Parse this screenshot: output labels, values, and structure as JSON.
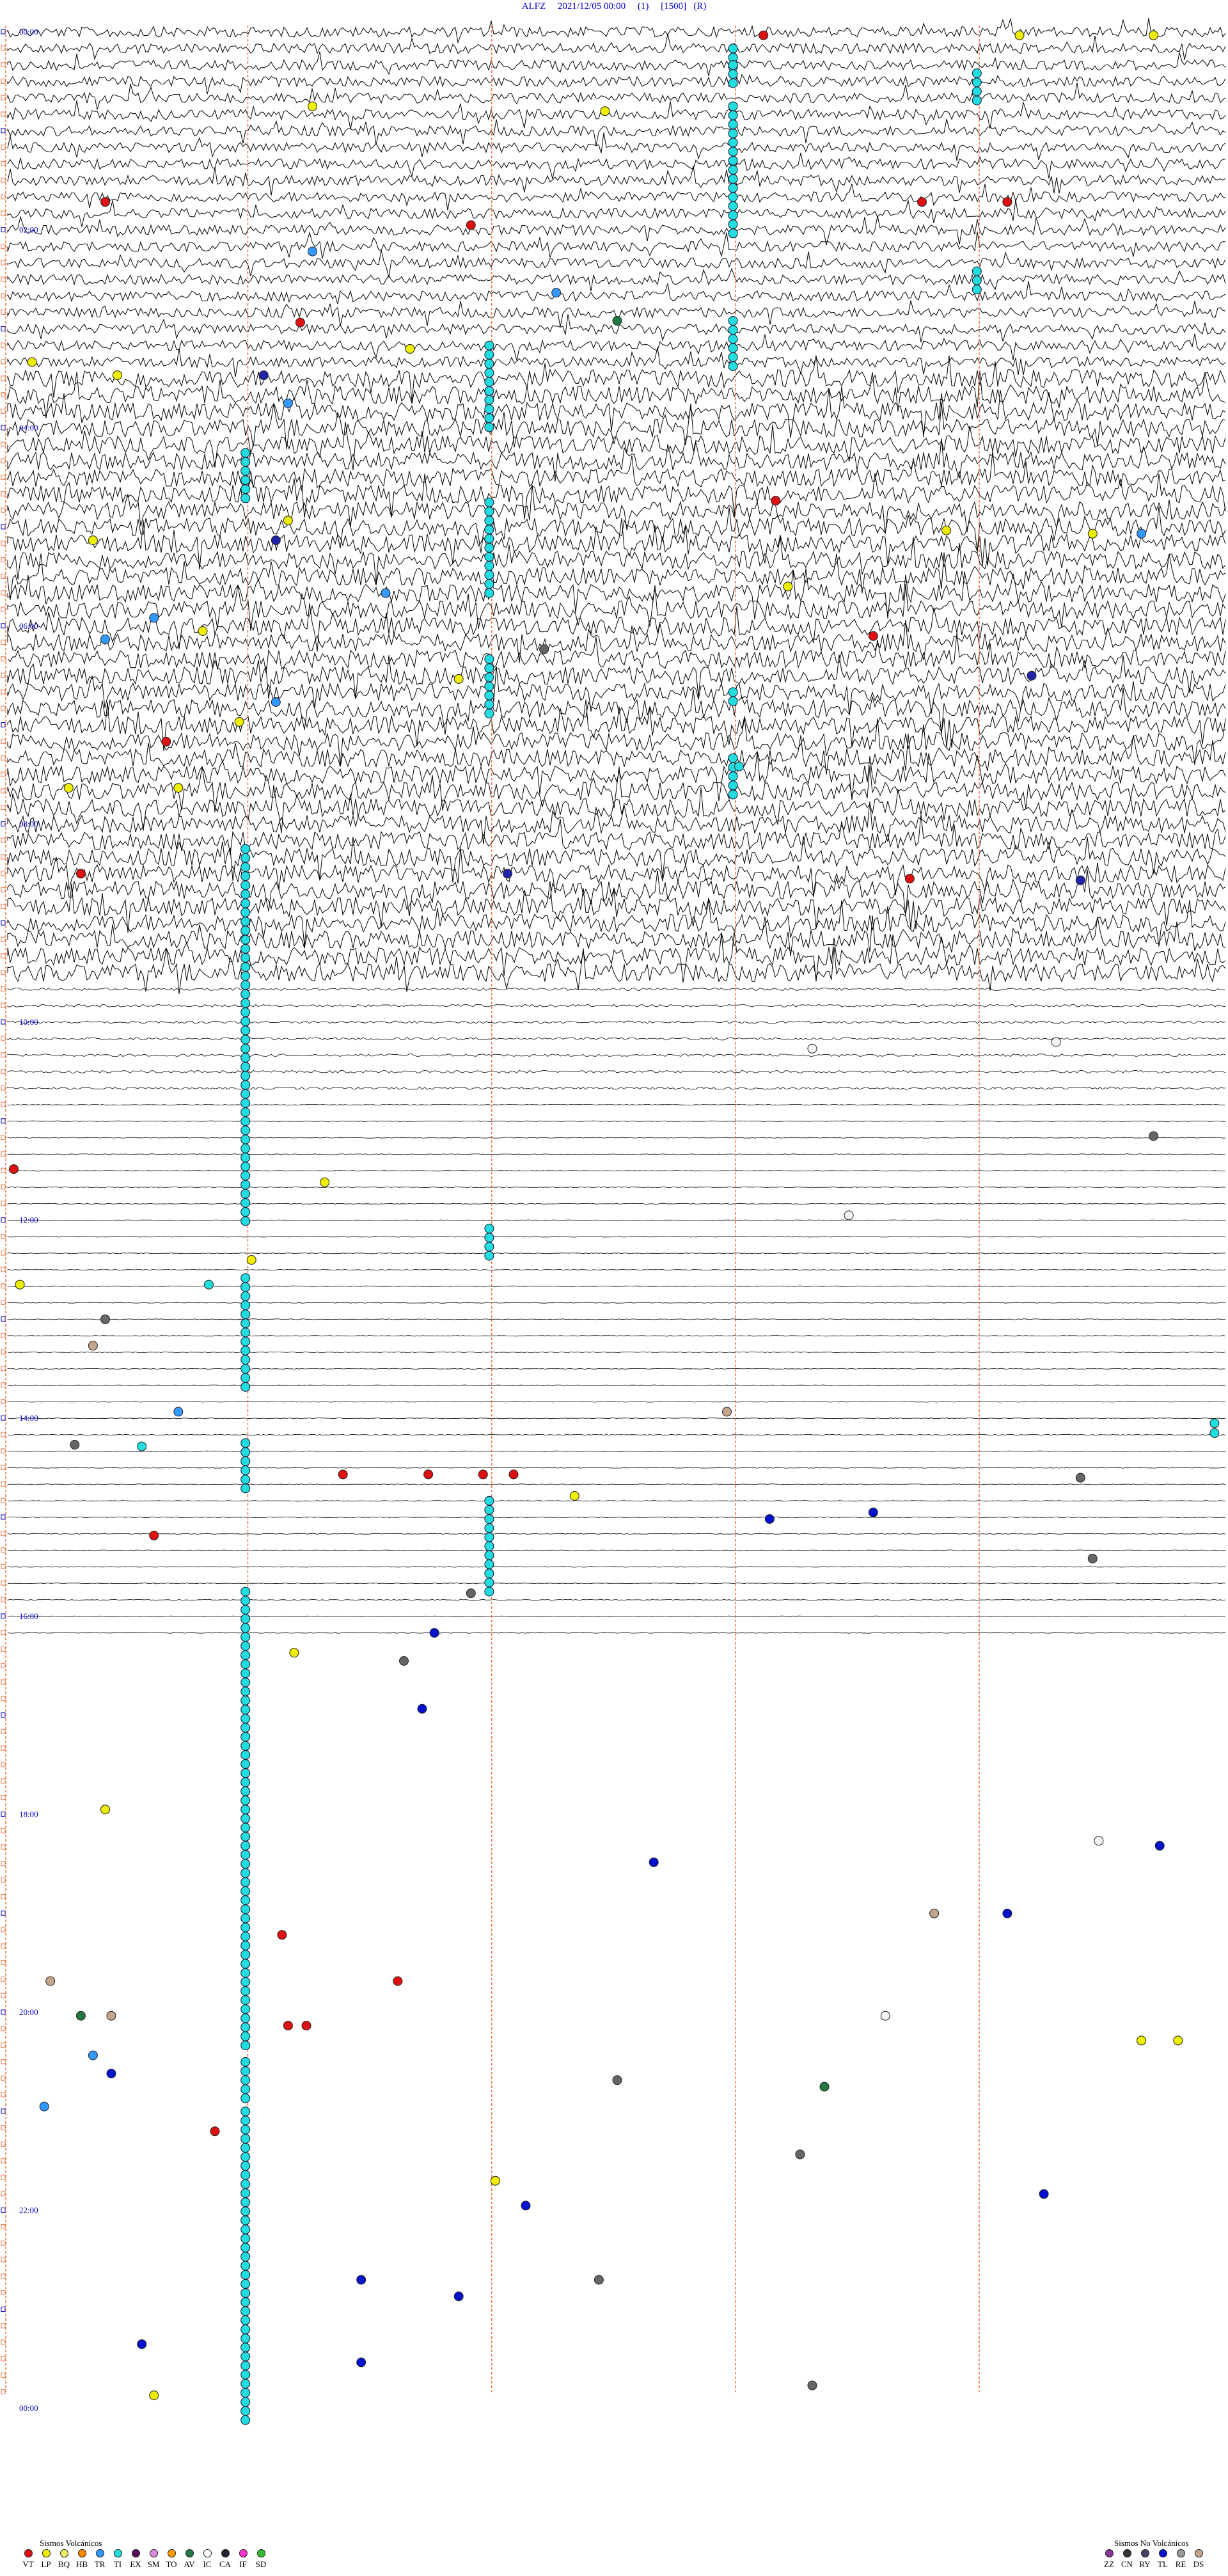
{
  "header": {
    "station": "ALFZ",
    "datetime": "2021/12/05 00:00",
    "channel": "(1)",
    "scale": "[1500]",
    "mode": "(R)"
  },
  "chart_data": {
    "type": "scatter",
    "rows_per_hour": 6,
    "hours": 24,
    "hour_labels": [
      "00:00",
      "02:00",
      "04:00",
      "06:00",
      "08:00",
      "10:00",
      "12:00",
      "14:00",
      "16:00",
      "18:00",
      "20:00",
      "22:00",
      "00:00"
    ],
    "x_range": [
      0,
      10
    ],
    "row_range": [
      0,
      145
    ],
    "trace_until_row": 97,
    "x_unit": "minutes after row start",
    "row_unit": "10-minute row index",
    "trace_notes": "seismic waveform traces drawn rows 0-97; dense rows 0-57",
    "events": [
      {
        "row": 0.2,
        "x": 6.2,
        "type": "VT"
      },
      {
        "row": 0.2,
        "x": 8.3,
        "type": "LP"
      },
      {
        "row": 0.2,
        "x": 9.4,
        "type": "LP"
      },
      {
        "row": 4.5,
        "x": 2.5,
        "type": "LP"
      },
      {
        "row": 4.8,
        "x": 4.9,
        "type": "LP"
      },
      {
        "row": 10.3,
        "x": 0.8,
        "type": "VT"
      },
      {
        "row": 10.3,
        "x": 7.5,
        "type": "VT"
      },
      {
        "row": 10.3,
        "x": 8.2,
        "type": "VT"
      },
      {
        "row": 11.7,
        "x": 3.8,
        "type": "VT"
      },
      {
        "row": 13.3,
        "x": 2.5,
        "type": "TR"
      },
      {
        "row": 15.8,
        "x": 4.5,
        "type": "TR"
      },
      {
        "row": 17.5,
        "x": 5.0,
        "type": "AV"
      },
      {
        "row": 17.6,
        "x": 2.4,
        "type": "VT"
      },
      {
        "row": 19.2,
        "x": 3.3,
        "type": "LP"
      },
      {
        "row": 20.0,
        "x": 0.2,
        "type": "LP"
      },
      {
        "row": 20.8,
        "x": 0.9,
        "type": "LP"
      },
      {
        "row": 20.8,
        "x": 2.1,
        "type": "RY"
      },
      {
        "row": 22.5,
        "x": 2.3,
        "type": "TR"
      },
      {
        "row": 28.4,
        "x": 6.3,
        "type": "VT"
      },
      {
        "row": 29.6,
        "x": 2.3,
        "type": "LP"
      },
      {
        "row": 30.2,
        "x": 7.7,
        "type": "LP"
      },
      {
        "row": 30.4,
        "x": 8.9,
        "type": "LP"
      },
      {
        "row": 30.4,
        "x": 9.3,
        "type": "TR"
      },
      {
        "row": 30.8,
        "x": 0.7,
        "type": "LP"
      },
      {
        "row": 30.8,
        "x": 2.2,
        "type": "RY"
      },
      {
        "row": 33.6,
        "x": 6.4,
        "type": "LP"
      },
      {
        "row": 34.0,
        "x": 3.1,
        "type": "TR"
      },
      {
        "row": 35.5,
        "x": 1.2,
        "type": "TR"
      },
      {
        "row": 36.3,
        "x": 1.6,
        "type": "LP"
      },
      {
        "row": 36.6,
        "x": 7.1,
        "type": "VT"
      },
      {
        "row": 36.8,
        "x": 0.8,
        "type": "TR"
      },
      {
        "row": 37.4,
        "x": 4.4,
        "type": "ZZ"
      },
      {
        "row": 39.0,
        "x": 8.4,
        "type": "RY"
      },
      {
        "row": 39.2,
        "x": 3.7,
        "type": "LP"
      },
      {
        "row": 40.6,
        "x": 2.2,
        "type": "TR"
      },
      {
        "row": 41.8,
        "x": 1.9,
        "type": "LP"
      },
      {
        "row": 43.0,
        "x": 1.3,
        "type": "VT"
      },
      {
        "row": 44.5,
        "x": 6.0,
        "type": "TI"
      },
      {
        "row": 45.8,
        "x": 0.5,
        "type": "LP"
      },
      {
        "row": 45.8,
        "x": 1.4,
        "type": "LP"
      },
      {
        "row": 51.0,
        "x": 0.6,
        "type": "VT"
      },
      {
        "row": 51.0,
        "x": 4.1,
        "type": "RY"
      },
      {
        "row": 51.3,
        "x": 7.4,
        "type": "VT"
      },
      {
        "row": 51.4,
        "x": 8.8,
        "type": "RY"
      },
      {
        "row": 61.2,
        "x": 8.6,
        "type": "IC"
      },
      {
        "row": 61.6,
        "x": 6.6,
        "type": "IC"
      },
      {
        "row": 66.9,
        "x": 9.4,
        "type": "ZZ"
      },
      {
        "row": 68.9,
        "x": 0.05,
        "type": "VT"
      },
      {
        "row": 69.7,
        "x": 2.6,
        "type": "LP"
      },
      {
        "row": 71.7,
        "x": 6.9,
        "type": "IC"
      },
      {
        "row": 74.4,
        "x": 2.0,
        "type": "LP"
      },
      {
        "row": 75.9,
        "x": 0.1,
        "type": "LP"
      },
      {
        "row": 75.9,
        "x": 1.65,
        "type": "TI"
      },
      {
        "row": 78.0,
        "x": 0.8,
        "type": "ZZ"
      },
      {
        "row": 79.6,
        "x": 0.7,
        "type": "DS"
      },
      {
        "row": 83.6,
        "x": 1.4,
        "type": "TR"
      },
      {
        "row": 83.6,
        "x": 5.9,
        "type": "DS"
      },
      {
        "row": 84.3,
        "x": 9.9,
        "type": "TI"
      },
      {
        "row": 84.9,
        "x": 9.9,
        "type": "TI"
      },
      {
        "row": 85.6,
        "x": 0.55,
        "type": "ZZ"
      },
      {
        "row": 85.7,
        "x": 1.1,
        "type": "TI"
      },
      {
        "row": 87.4,
        "x": 2.75,
        "type": "VT"
      },
      {
        "row": 87.4,
        "x": 3.45,
        "type": "VT"
      },
      {
        "row": 87.4,
        "x": 3.9,
        "type": "VT"
      },
      {
        "row": 87.4,
        "x": 4.15,
        "type": "VT"
      },
      {
        "row": 87.6,
        "x": 8.8,
        "type": "ZZ"
      },
      {
        "row": 88.7,
        "x": 4.65,
        "type": "LP"
      },
      {
        "row": 90.1,
        "x": 6.25,
        "type": "TL"
      },
      {
        "row": 89.7,
        "x": 7.1,
        "type": "TL"
      },
      {
        "row": 91.1,
        "x": 1.2,
        "type": "VT"
      },
      {
        "row": 92.5,
        "x": 8.9,
        "type": "ZZ"
      },
      {
        "row": 94.6,
        "x": 3.8,
        "type": "ZZ"
      },
      {
        "row": 97.0,
        "x": 3.5,
        "type": "TL"
      },
      {
        "row": 98.2,
        "x": 2.35,
        "type": "LP"
      },
      {
        "row": 98.7,
        "x": 3.25,
        "type": "ZZ"
      },
      {
        "row": 101.6,
        "x": 3.4,
        "type": "TL"
      },
      {
        "row": 107.7,
        "x": 0.8,
        "type": "LP"
      },
      {
        "row": 109.6,
        "x": 8.95,
        "type": "IC"
      },
      {
        "row": 109.9,
        "x": 9.45,
        "type": "TL"
      },
      {
        "row": 110.9,
        "x": 5.3,
        "type": "TL"
      },
      {
        "row": 114.0,
        "x": 7.6,
        "type": "DS"
      },
      {
        "row": 114.0,
        "x": 8.2,
        "type": "TL"
      },
      {
        "row": 115.3,
        "x": 2.25,
        "type": "VT"
      },
      {
        "row": 118.1,
        "x": 0.35,
        "type": "DS"
      },
      {
        "row": 118.1,
        "x": 3.2,
        "type": "VT"
      },
      {
        "row": 120.2,
        "x": 0.6,
        "type": "AV"
      },
      {
        "row": 120.2,
        "x": 0.85,
        "type": "DS"
      },
      {
        "row": 120.2,
        "x": 7.2,
        "type": "IC"
      },
      {
        "row": 120.8,
        "x": 2.3,
        "type": "VT"
      },
      {
        "row": 120.8,
        "x": 2.45,
        "type": "VT"
      },
      {
        "row": 121.7,
        "x": 9.3,
        "type": "LP"
      },
      {
        "row": 121.7,
        "x": 9.6,
        "type": "LP"
      },
      {
        "row": 122.6,
        "x": 0.7,
        "type": "TR"
      },
      {
        "row": 123.7,
        "x": 0.85,
        "type": "TL"
      },
      {
        "row": 124.1,
        "x": 5.0,
        "type": "ZZ"
      },
      {
        "row": 124.5,
        "x": 6.7,
        "type": "AV"
      },
      {
        "row": 125.7,
        "x": 0.3,
        "type": "TR"
      },
      {
        "row": 127.2,
        "x": 1.7,
        "type": "VT"
      },
      {
        "row": 128.6,
        "x": 6.5,
        "type": "ZZ"
      },
      {
        "row": 130.2,
        "x": 4.0,
        "type": "LP"
      },
      {
        "row": 131.0,
        "x": 8.5,
        "type": "TL"
      },
      {
        "row": 131.7,
        "x": 4.25,
        "type": "TL"
      },
      {
        "row": 136.2,
        "x": 2.9,
        "type": "TL"
      },
      {
        "row": 136.2,
        "x": 4.85,
        "type": "ZZ"
      },
      {
        "row": 137.2,
        "x": 3.7,
        "type": "TL"
      },
      {
        "row": 140.1,
        "x": 1.1,
        "type": "TL"
      },
      {
        "row": 141.2,
        "x": 2.9,
        "type": "TL"
      },
      {
        "row": 142.6,
        "x": 6.6,
        "type": "ZZ"
      },
      {
        "row": 143.2,
        "x": 1.2,
        "type": "LP"
      }
    ],
    "ti_columns": [
      {
        "x": 5.95,
        "row_start": 1.0,
        "row_end": 2.5
      },
      {
        "x": 5.95,
        "row_start": 2.0,
        "row_end": 3.5
      },
      {
        "x": 5.95,
        "row_start": 4.5,
        "row_end": 12.5
      },
      {
        "x": 5.95,
        "row_start": 17.5,
        "row_end": 20.5
      },
      {
        "x": 7.95,
        "row_start": 2.5,
        "row_end": 4.5
      },
      {
        "x": 7.95,
        "row_start": 14.5,
        "row_end": 16.0
      },
      {
        "x": 3.95,
        "row_start": 19.0,
        "row_end": 24.5
      },
      {
        "x": 3.95,
        "row_start": 28.5,
        "row_end": 34.5
      },
      {
        "x": 1.95,
        "row_start": 25.5,
        "row_end": 28.5
      },
      {
        "x": 3.95,
        "row_start": 38.0,
        "row_end": 41.5
      },
      {
        "x": 5.95,
        "row_start": 44.0,
        "row_end": 46.5
      },
      {
        "x": 5.95,
        "row_start": 40.0,
        "row_end": 41.0
      },
      {
        "x": 1.95,
        "row_start": 49.5,
        "row_end": 72.5
      },
      {
        "x": 3.95,
        "row_start": 72.5,
        "row_end": 74.5
      },
      {
        "x": 1.95,
        "row_start": 75.5,
        "row_end": 82.5
      },
      {
        "x": 1.95,
        "row_start": 85.5,
        "row_end": 88.5
      },
      {
        "x": 3.95,
        "row_start": 89.0,
        "row_end": 94.5
      },
      {
        "x": 1.95,
        "row_start": 94.5,
        "row_end": 122.5
      },
      {
        "x": 1.95,
        "row_start": 123.0,
        "row_end": 125.5
      },
      {
        "x": 1.95,
        "row_start": 126.0,
        "row_end": 145.0
      }
    ]
  },
  "legend_volcanic": {
    "title": "Sismos Volcánicos",
    "items": [
      {
        "code": "VT",
        "color": "#dd1111"
      },
      {
        "code": "LP",
        "color": "#eeee00"
      },
      {
        "code": "BQ",
        "color": "#eeee66"
      },
      {
        "code": "HB",
        "color": "#ff8800"
      },
      {
        "code": "TR",
        "color": "#3399ff"
      },
      {
        "code": "TI",
        "color": "#22dddd"
      },
      {
        "code": "EX",
        "color": "#551155"
      },
      {
        "code": "SM",
        "color": "#dd88dd"
      },
      {
        "code": "TO",
        "color": "#ff9900"
      },
      {
        "code": "AV",
        "color": "#227744"
      },
      {
        "code": "IC",
        "color": "#ffffff"
      },
      {
        "code": "CA",
        "color": "#222233"
      },
      {
        "code": "IF",
        "color": "#ff33cc"
      },
      {
        "code": "SD",
        "color": "#33bb33"
      }
    ]
  },
  "legend_nonvolcanic": {
    "title": "Sismos No Volcánicos",
    "items": [
      {
        "code": "ZZ",
        "color": "#883399"
      },
      {
        "code": "CN",
        "color": "#333333"
      },
      {
        "code": "RY",
        "color": "#444466"
      },
      {
        "code": "TL",
        "color": "#0011cc"
      },
      {
        "code": "RE",
        "color": "#999999"
      },
      {
        "code": "DS",
        "color": "#c4a48a"
      }
    ]
  },
  "type_colors": {
    "VT": "#dd1111",
    "LP": "#eeee00",
    "TR": "#3399ff",
    "TI": "#22dddd",
    "AV": "#227744",
    "IC": "#f4f4f4",
    "ZZ": "#666666",
    "RY": "#2222aa",
    "TL": "#0011cc",
    "DS": "#c4a48a"
  }
}
